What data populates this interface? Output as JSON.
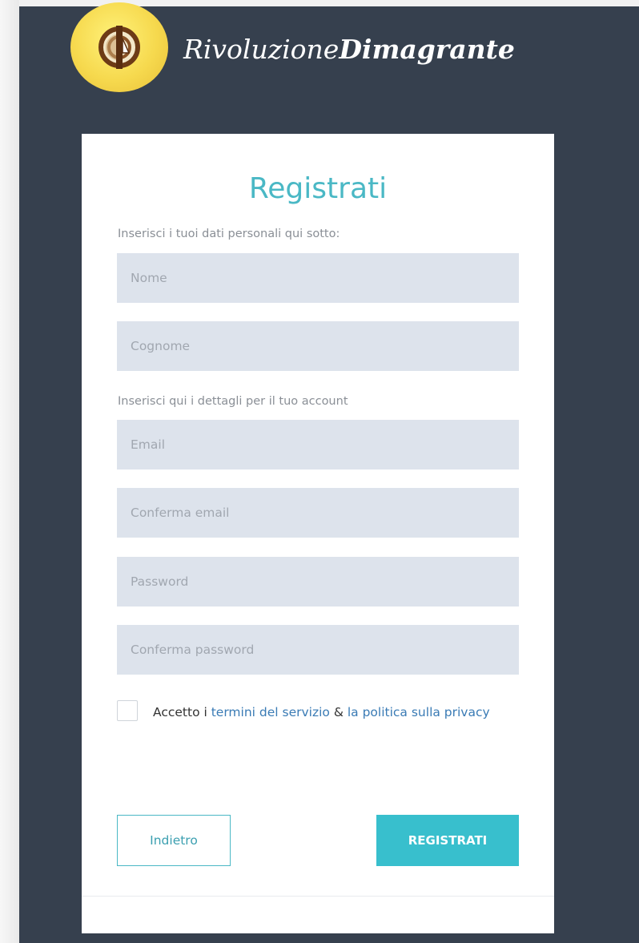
{
  "brand": {
    "name_part1": "Rivoluzione",
    "name_part2": "Dimagrante"
  },
  "form": {
    "title": "Registrati",
    "personal_label": "Inserisci i tuoi dati personali qui sotto:",
    "account_label": "Inserisci qui i dettagli per il tuo account",
    "fields": {
      "first_name": {
        "placeholder": "Nome",
        "value": ""
      },
      "last_name": {
        "placeholder": "Cognome",
        "value": ""
      },
      "email": {
        "placeholder": "Email",
        "value": ""
      },
      "confirm_email": {
        "placeholder": "Conferma email",
        "value": ""
      },
      "password": {
        "placeholder": "Password",
        "value": ""
      },
      "confirm_password": {
        "placeholder": "Conferma password",
        "value": ""
      }
    },
    "terms": {
      "checked": false,
      "prefix": "Accetto i ",
      "terms_link": "termini del servizio",
      "ampersand": " & ",
      "privacy_link": "la politica sulla privacy"
    },
    "buttons": {
      "back": "Indietro",
      "submit": "REGISTRATI"
    }
  },
  "colors": {
    "page_background": "#36404e",
    "accent": "#38bfcd",
    "title": "#4ab8c5",
    "input_background": "#dde3ec",
    "link": "#3a7bb5"
  },
  "icons": {
    "logo": "brand-logo-icon"
  }
}
